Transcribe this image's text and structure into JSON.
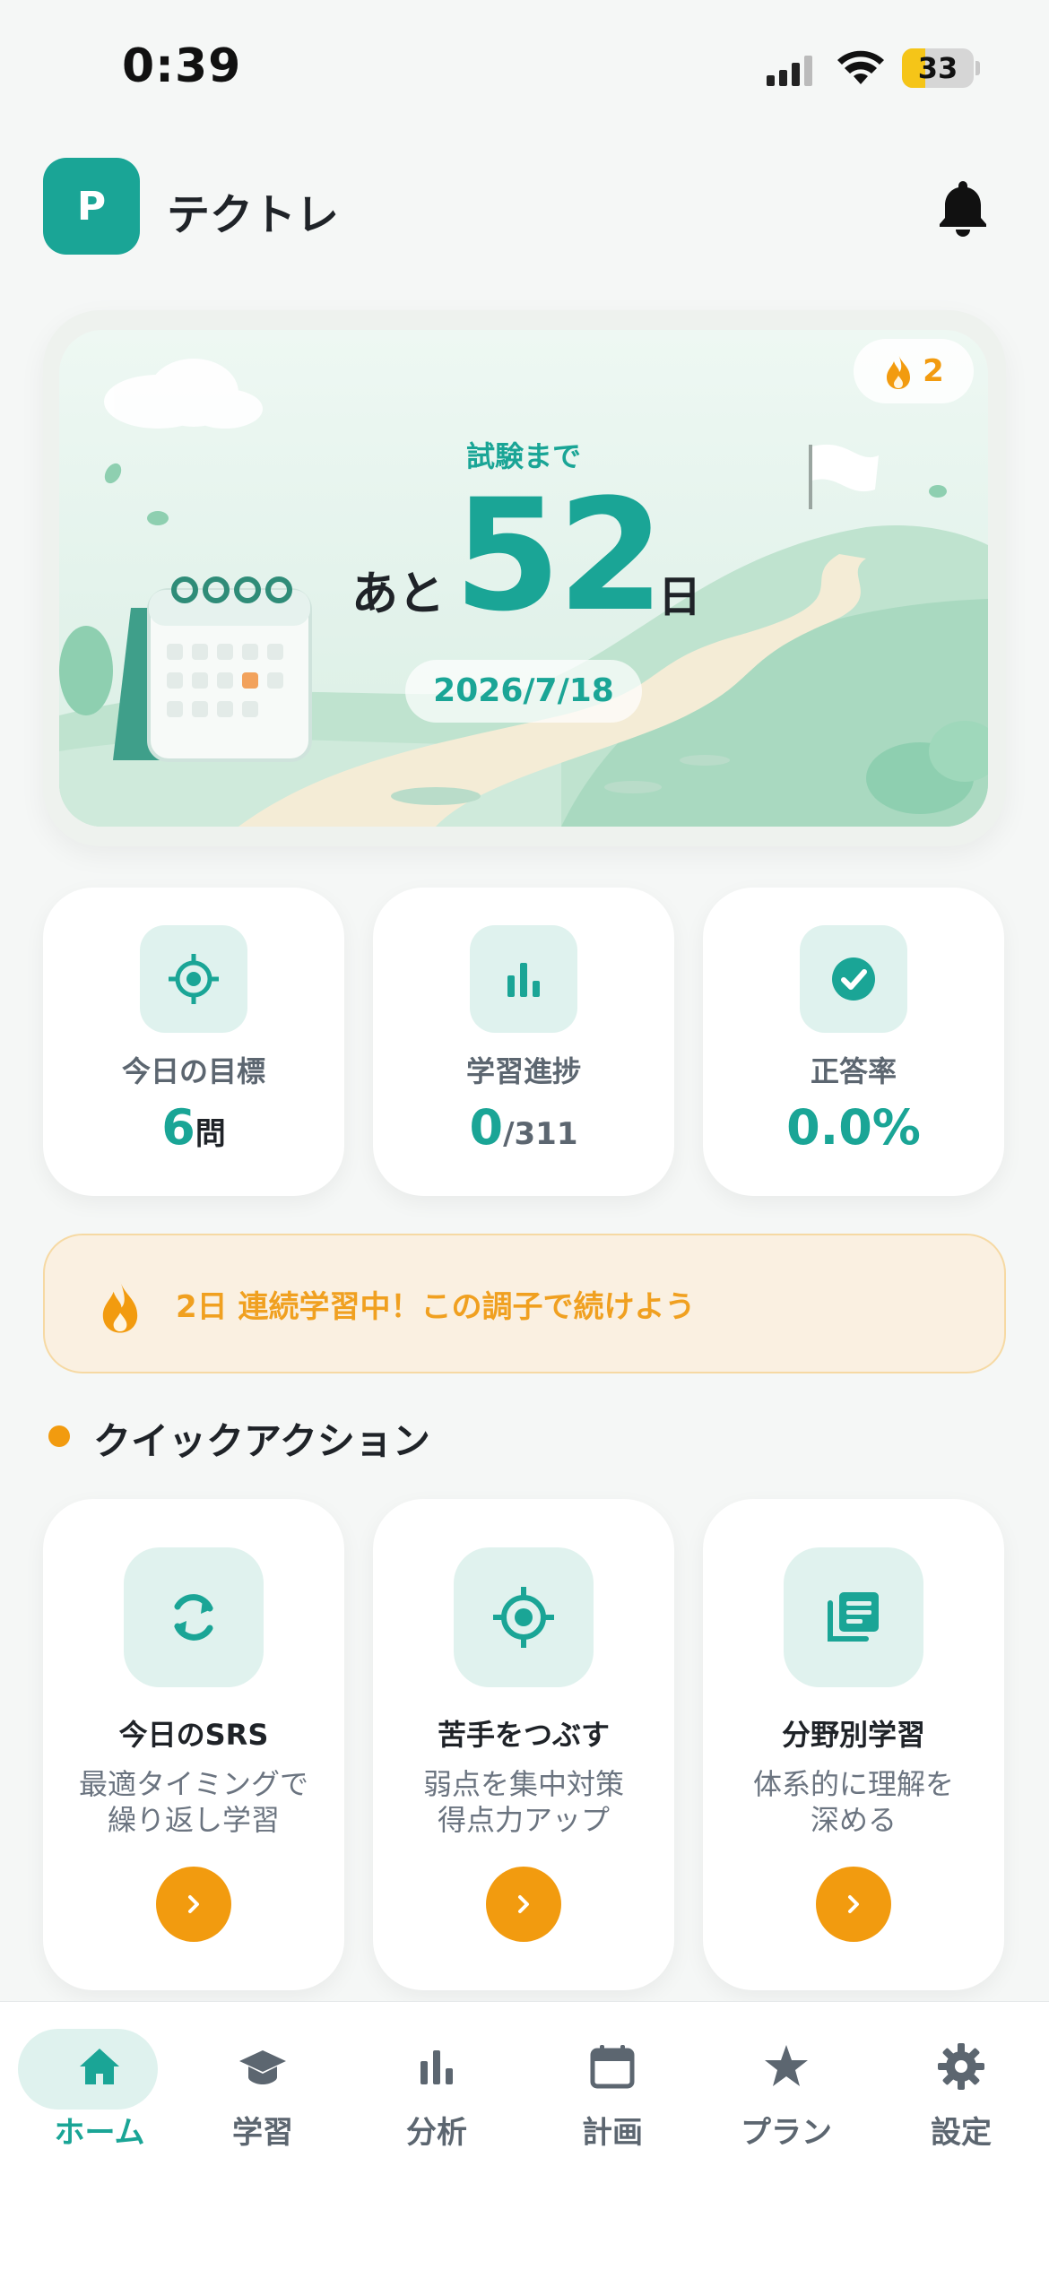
{
  "status_bar": {
    "time": "0:39",
    "battery": "33",
    "battery_level": 0.33
  },
  "header": {
    "logo_letter": "P",
    "app_name": "テクトレ"
  },
  "hero": {
    "streak_count": "2",
    "exam_label": "試験まで",
    "prefix": "あと",
    "days": "52",
    "suffix": "日",
    "exam_date": "2026/7/18"
  },
  "stats": [
    {
      "label": "今日の目標",
      "value": "6",
      "unit": "問",
      "icon": "target-icon"
    },
    {
      "label": "学習進捗",
      "value": "0",
      "unit": "/311",
      "icon": "bar-chart-icon"
    },
    {
      "label": "正答率",
      "value": "0.0%",
      "unit": "",
      "icon": "check-circle-icon"
    }
  ],
  "streak_banner": {
    "text": "2日 連続学習中！この調子で続けよう"
  },
  "quick_actions": {
    "title": "クイックアクション",
    "items": [
      {
        "title": "今日のSRS",
        "desc1": "最適タイミングで",
        "desc2": "繰り返し学習",
        "icon": "refresh-icon"
      },
      {
        "title": "苦手をつぶす",
        "desc1": "弱点を集中対策",
        "desc2": "得点力アップ",
        "icon": "target-icon"
      },
      {
        "title": "分野別学習",
        "desc1": "体系的に理解を",
        "desc2": "深める",
        "icon": "library-icon"
      }
    ]
  },
  "tabs": [
    {
      "label": "ホーム",
      "icon": "home-icon",
      "active": true
    },
    {
      "label": "学習",
      "icon": "graduation-cap-icon",
      "active": false
    },
    {
      "label": "分析",
      "icon": "bar-chart-icon",
      "active": false
    },
    {
      "label": "計画",
      "icon": "calendar-icon",
      "active": false
    },
    {
      "label": "プラン",
      "icon": "star-icon",
      "active": false
    },
    {
      "label": "設定",
      "icon": "gear-icon",
      "active": false
    }
  ],
  "colors": {
    "accent": "#1aa596",
    "orange": "#f29b0f",
    "streak_text": "#f0a020"
  }
}
